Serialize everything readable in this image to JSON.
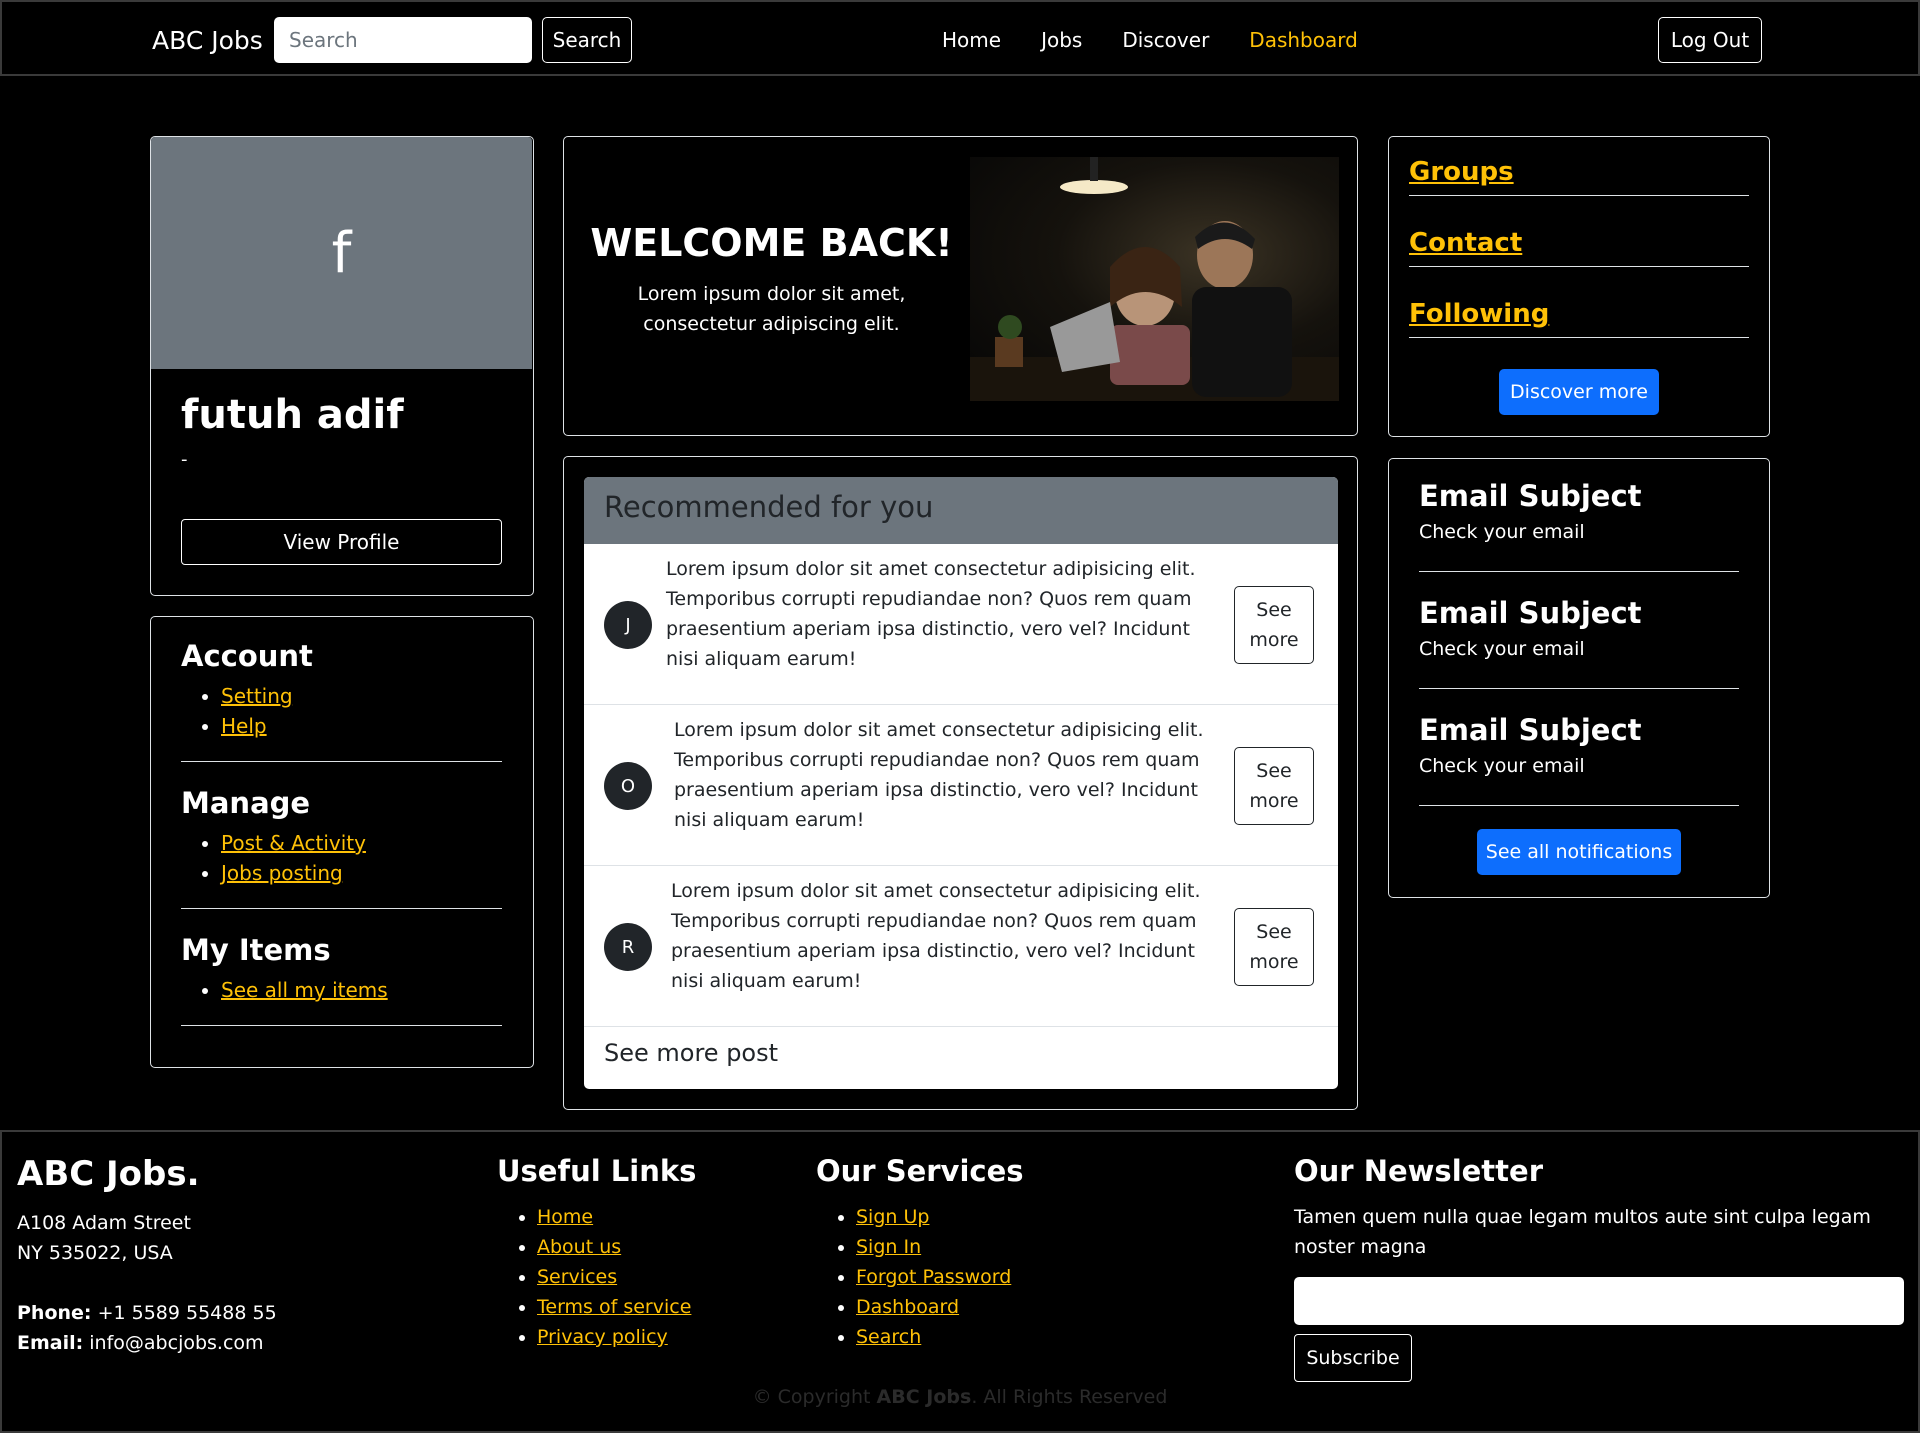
{
  "navbar": {
    "brand": "ABC Jobs",
    "search_placeholder": "Search",
    "search_button": "Search",
    "links": [
      {
        "label": "Home",
        "active": false
      },
      {
        "label": "Jobs",
        "active": false
      },
      {
        "label": "Discover",
        "active": false
      },
      {
        "label": "Dashboard",
        "active": true
      }
    ],
    "logout": "Log Out"
  },
  "profile": {
    "initial": "f",
    "name": "futuh adif",
    "subtitle": "-",
    "view_button": "View Profile"
  },
  "menu": {
    "sections": [
      {
        "title": "Account",
        "items": [
          "Setting",
          "Help"
        ]
      },
      {
        "title": "Manage",
        "items": [
          "Post & Activity",
          "Jobs posting"
        ]
      },
      {
        "title": "My Items",
        "items": [
          "See all my items"
        ]
      }
    ]
  },
  "welcome": {
    "title": "WELCOME BACK!",
    "text": "Lorem ipsum dolor sit amet, consectetur adipiscing elit."
  },
  "recommended": {
    "title": "Recommended for you",
    "items": [
      {
        "initial": "J",
        "text": "Lorem ipsum dolor sit amet consectetur adipisicing elit. Temporibus corrupti repudiandae non? Quos rem quam praesentium aperiam ipsa distinctio, vero vel? Incidunt nisi aliquam earum!",
        "button": "See more"
      },
      {
        "initial": "O",
        "text": "Lorem ipsum dolor sit amet consectetur adipisicing elit. Temporibus corrupti repudiandae non? Quos rem quam praesentium aperiam ipsa distinctio, vero vel? Incidunt nisi aliquam earum!",
        "button": "See more"
      },
      {
        "initial": "R",
        "text": "Lorem ipsum dolor sit amet consectetur adipisicing elit. Temporibus corrupti repudiandae non? Quos rem quam praesentium aperiam ipsa distinctio, vero vel? Incidunt nisi aliquam earum!",
        "button": "See more"
      }
    ],
    "footer": "See more post"
  },
  "links_card": {
    "links": [
      "Groups",
      "Contact",
      "Following"
    ],
    "button": "Discover more"
  },
  "notifications": {
    "items": [
      {
        "subject": "Email Subject",
        "text": "Check your email"
      },
      {
        "subject": "Email Subject",
        "text": "Check your email"
      },
      {
        "subject": "Email Subject",
        "text": "Check your email"
      }
    ],
    "button": "See all notifications"
  },
  "footer": {
    "brand": "ABC Jobs.",
    "address_line1": "A108 Adam Street",
    "address_line2": "NY 535022, USA",
    "phone_label": "Phone:",
    "phone": "+1 5589 55488 55",
    "email_label": "Email:",
    "email": "info@abcjobs.com",
    "useful_links_title": "Useful Links",
    "useful_links": [
      "Home",
      "About us",
      "Services",
      "Terms of service",
      "Privacy policy"
    ],
    "services_title": "Our Services",
    "services": [
      "Sign Up",
      "Sign In",
      "Forgot Password",
      "Dashboard",
      "Search"
    ],
    "newsletter_title": "Our Newsletter",
    "newsletter_text": "Tamen quem nulla quae legam multos aute sint culpa legam noster magna",
    "subscribe": "Subscribe",
    "copyright_prefix": "© Copyright",
    "copyright_brand": "ABC Jobs",
    "copyright_suffix": ". All Rights Reserved"
  },
  "colors": {
    "accent": "#ffc107",
    "primary": "#0d6efd",
    "secondary": "#6c757d",
    "background": "#000000"
  }
}
